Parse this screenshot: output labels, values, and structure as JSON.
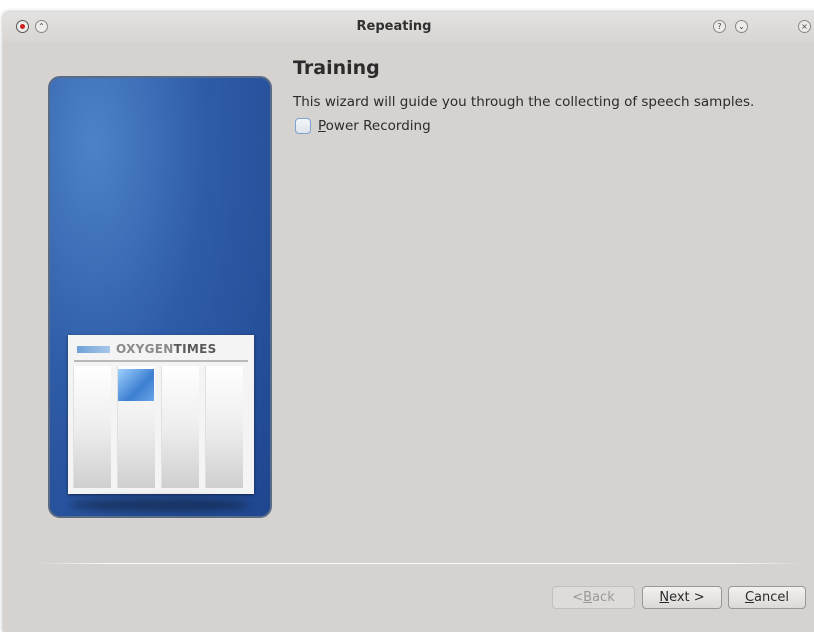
{
  "window": {
    "title": "Repeating",
    "controls": {
      "close": "close-icon",
      "shade": "shade-icon",
      "help": "?",
      "minimize": "⌄",
      "exit": "×"
    }
  },
  "side_panel": {
    "newspaper_title_light": "OXYGEN",
    "newspaper_title_bold": "TIMES",
    "colors": {
      "panel": "#2f5ca8",
      "logo_bar": "#6fa0d8"
    }
  },
  "page": {
    "heading": "Training",
    "description": "This wizard will guide you through the collecting of speech samples.",
    "checkbox": {
      "label_mnemonic": "P",
      "label_rest": "ower Recording",
      "checked": false
    }
  },
  "buttons": {
    "back_prefix": "< ",
    "back_mnemonic": "B",
    "back_rest": "ack",
    "back_enabled": false,
    "next_mnemonic": "N",
    "next_rest": "ext >",
    "cancel_mnemonic": "C",
    "cancel_rest": "ancel"
  }
}
